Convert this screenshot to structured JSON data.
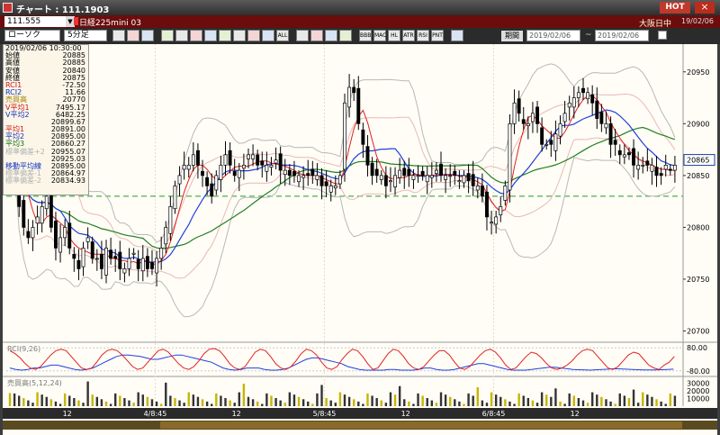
{
  "window": {
    "title": "チャート : 111.1903",
    "hot_label": "HOT",
    "close_label": "×"
  },
  "instrument": {
    "code": "111.555",
    "name": "日経225mini 03",
    "market": "大阪日中",
    "date": "19/02/06"
  },
  "toolbar": {
    "chart_type": "ローソク",
    "interval": "5分足",
    "icon_buttons": [
      "search-icon",
      "zoom-icon",
      "grid-icon",
      "cross-icon",
      "line-icon",
      "fibo-icon",
      "rect-icon",
      "arrow-icon",
      "text-icon",
      "trend-icon",
      "erase-icon",
      "all-icon",
      "bar-icon",
      "sma-icon",
      "color-icon",
      "pen-icon",
      "bb-icon",
      "mac-icon",
      "hl-icon",
      "atr-icon",
      "rsi-icon",
      "pnt-icon",
      "opt-icon"
    ],
    "icon_texts": [
      "",
      "",
      "",
      "",
      "",
      "",
      "",
      "",
      "",
      "",
      "",
      "ALL",
      "",
      "",
      "",
      "",
      "BBB",
      "MAC",
      "HL",
      "ATR",
      "RSI",
      "PNT",
      ""
    ],
    "period_label": "期間",
    "date_from": "2019/02/06",
    "date_to": "2019/02/06",
    "tilde": "~"
  },
  "info_panel": {
    "datetime": "2019/02/06   10:30:00",
    "rows": [
      {
        "label": "始値",
        "value": "20885",
        "color": "#000000"
      },
      {
        "label": "高値",
        "value": "20885",
        "color": "#000000"
      },
      {
        "label": "安値",
        "value": "20840",
        "color": "#000000"
      },
      {
        "label": "終値",
        "value": "20875",
        "color": "#000000"
      },
      {
        "label": "RCI1",
        "value": "-72.50",
        "color": "#d01010"
      },
      {
        "label": "RCI2",
        "value": "11.66",
        "color": "#1030c0"
      },
      {
        "label": "売買高",
        "value": "20770",
        "color": "#a08000"
      },
      {
        "label": "V平均1",
        "value": "7495.17",
        "color": "#d01010"
      },
      {
        "label": "V平均2",
        "value": "6482.25",
        "color": "#1030c0"
      },
      {
        "label": "",
        "value": "20899.67",
        "color": "#000000"
      },
      {
        "label": "平均1",
        "value": "20891.00",
        "color": "#d01010"
      },
      {
        "label": "平均2",
        "value": "20895.00",
        "color": "#1030c0"
      },
      {
        "label": "平均3",
        "value": "20860.27",
        "color": "#107010"
      },
      {
        "label": "標準偏差+2",
        "value": "20955.07",
        "color": "#b0b0b0"
      },
      {
        "label": "",
        "value": "20925.03",
        "color": "#000000"
      },
      {
        "label": "移動平均線",
        "value": "20895.00",
        "color": "#1030c0"
      },
      {
        "label": "標準偏差-1",
        "value": "20864.97",
        "color": "#b0b0b0"
      },
      {
        "label": "標準偏差-2",
        "value": "20834.93",
        "color": "#b0b0b0"
      }
    ]
  },
  "price_axis": {
    "ticks": [
      "20950",
      "20900",
      "20850",
      "20800",
      "20750",
      "20700"
    ],
    "current": "20865"
  },
  "rci_panel": {
    "label": "RCI(9,26)",
    "ticks": [
      "80.00",
      "-80.00"
    ]
  },
  "volume_panel": {
    "label": "売買高(5,12,24)",
    "ticks": [
      "30000",
      "20000",
      "10000"
    ]
  },
  "time_axis": {
    "labels": [
      "12",
      "4/8:45",
      "12",
      "5/8:45",
      "12",
      "6/8:45",
      "12"
    ]
  },
  "colors": {
    "up": "#ffffff",
    "down": "#000000",
    "ma1": "#e02020",
    "ma2": "#2040e0",
    "ma3": "#208020",
    "bb": "#b8b8b8",
    "ref": "#20a020",
    "rci1": "#e02020",
    "rci2": "#2040e0",
    "vol": "#c8b400"
  },
  "chart_data": {
    "type": "candlestick",
    "ylim": [
      20690,
      20975
    ],
    "reference_line": 20830,
    "closes": [
      20880,
      20870,
      20820,
      20800,
      20790,
      20800,
      20810,
      20820,
      20830,
      20800,
      20780,
      20790,
      20800,
      20780,
      20770,
      20760,
      20780,
      20790,
      20770,
      20770,
      20760,
      20780,
      20770,
      20770,
      20760,
      20760,
      20770,
      20775,
      20760,
      20770,
      20760,
      20760,
      20770,
      20780,
      20800,
      20820,
      20840,
      20850,
      20860,
      20860,
      20870,
      20860,
      20850,
      20840,
      20830,
      20850,
      20860,
      20870,
      20860,
      20850,
      20855,
      20860,
      20870,
      20870,
      20860,
      20860,
      20860,
      20860,
      20865,
      20855,
      20855,
      20850,
      20850,
      20850,
      20850,
      20850,
      20850,
      20850,
      20840,
      20840,
      20840,
      20840,
      20850,
      20920,
      20935,
      20930,
      20900,
      20880,
      20860,
      20850,
      20850,
      20850,
      20840,
      20845,
      20850,
      20855,
      20850,
      20850,
      20850,
      20850,
      20850,
      20850,
      20850,
      20855,
      20850,
      20850,
      20850,
      20850,
      20845,
      20850,
      20845,
      20840,
      20840,
      20830,
      20810,
      20805,
      20810,
      20820,
      20840,
      20900,
      20920,
      20910,
      20900,
      20900,
      20910,
      20900,
      20880,
      20880,
      20880,
      20890,
      20900,
      20910,
      20920,
      20925,
      20930,
      20930,
      20930,
      20920,
      20905,
      20900,
      20900,
      20880,
      20880,
      20870,
      20870,
      20870,
      20860,
      20860,
      20860,
      20860,
      20860,
      20850,
      20850,
      20860,
      20855,
      20860
    ],
    "rci1": [
      60,
      40,
      10,
      -30,
      -60,
      -70,
      -50,
      -10,
      30,
      60,
      70,
      60,
      20,
      -20,
      -60,
      -70,
      -60,
      -20,
      30,
      60,
      70,
      60,
      30,
      -10,
      -50,
      -70,
      -60,
      -20,
      20,
      60,
      70,
      50,
      10,
      -30,
      -60,
      -70,
      -50,
      -10,
      40,
      70,
      75,
      60,
      20,
      -30,
      -60,
      -70,
      -50,
      0,
      50,
      70,
      60,
      20,
      -30,
      -60,
      -70,
      -50,
      -10,
      40,
      70,
      60,
      30,
      -20,
      -60,
      -70,
      -50,
      0,
      40,
      70,
      60,
      20,
      -30,
      -70,
      -60,
      -10,
      40,
      70,
      60,
      20,
      -30,
      -60,
      -70,
      -50,
      -10,
      30,
      60,
      60,
      30,
      -20,
      -60,
      -70,
      -50,
      -10,
      30,
      60,
      70,
      50,
      10,
      -40,
      -70,
      -60,
      -20,
      20,
      50,
      40,
      10,
      -30,
      -60,
      -70,
      -60,
      -40,
      -10,
      30,
      60,
      70,
      60,
      20,
      -20,
      -60,
      -70,
      -50,
      -10,
      30,
      50,
      40,
      0,
      -40,
      -60,
      -70,
      -40,
      -20,
      20
    ],
    "rci2": [
      -60,
      -70,
      -75,
      -70,
      -60,
      -60,
      -50,
      -40,
      -40,
      -50,
      -60,
      -70,
      -75,
      -70,
      -60,
      -40,
      -20,
      0,
      20,
      30,
      30,
      25,
      20,
      10,
      0,
      0,
      10,
      20,
      30,
      30,
      20,
      10,
      0,
      -10,
      -20,
      -40,
      -60,
      -70,
      -75,
      -70,
      -60,
      -60,
      -60,
      -70,
      -75,
      -75,
      -70,
      -60,
      -40,
      -20,
      0,
      10,
      10,
      0,
      -10,
      -20,
      -30,
      -50,
      -60,
      -70,
      -75,
      -75,
      -75,
      -75,
      -70,
      -70,
      -75,
      -75,
      -75,
      -70,
      -60,
      -60,
      -70,
      -75,
      -75,
      -70,
      -60,
      -50,
      -40,
      -30,
      -30,
      -40,
      -50,
      -60,
      -70,
      -75,
      -75,
      -75,
      -70,
      -65,
      -60,
      -55,
      -55,
      -60,
      -65,
      -70,
      -72,
      -74,
      -75,
      -72,
      -70,
      -68,
      -65,
      -66,
      -68,
      -70,
      -72,
      -73,
      -74,
      -74,
      -72,
      -70,
      -68
    ]
  }
}
